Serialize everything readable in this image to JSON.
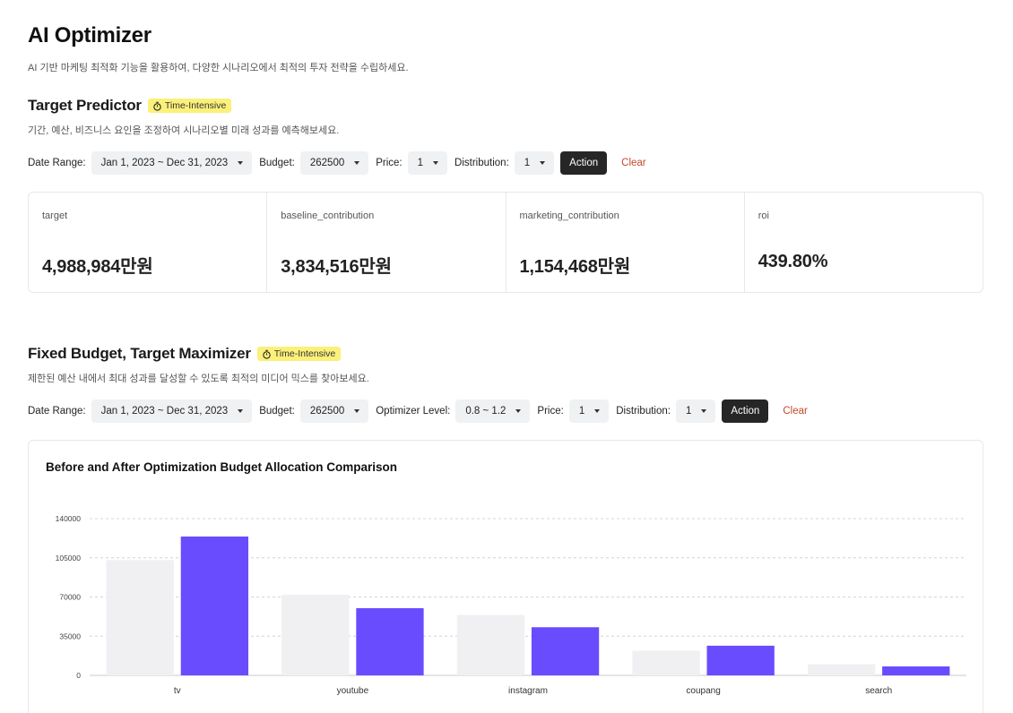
{
  "header": {
    "title": "AI Optimizer",
    "subtitle": "AI 기반 마케팅 최적화 기능을 활용하여, 다양한 시나리오에서 최적의 투자 전략을 수립하세요."
  },
  "predictor": {
    "title": "Target Predictor",
    "badge": "Time-Intensive",
    "description": "기간, 예산, 비즈니스 요인을 조정하여 시나리오별 미래 성과를 예측해보세요.",
    "controls": {
      "date_label": "Date Range:",
      "date_value": "Jan 1, 2023 ~ Dec 31, 2023",
      "budget_label": "Budget:",
      "budget_value": "262500",
      "price_label": "Price:",
      "price_value": "1",
      "distribution_label": "Distribution:",
      "distribution_value": "1",
      "action_label": "Action",
      "clear_label": "Clear"
    },
    "metrics": [
      {
        "label": "target",
        "value": "4,988,984만원"
      },
      {
        "label": "baseline_contribution",
        "value": "3,834,516만원"
      },
      {
        "label": "marketing_contribution",
        "value": "1,154,468만원"
      },
      {
        "label": "roi",
        "value": "439.80%"
      }
    ]
  },
  "maximizer": {
    "title": "Fixed Budget, Target Maximizer",
    "badge": "Time-Intensive",
    "description": "제한된 예산 내에서 최대 성과를 달성할 수 있도록 최적의 미디어 믹스를 찾아보세요.",
    "controls": {
      "date_label": "Date Range:",
      "date_value": "Jan 1, 2023 ~ Dec 31, 2023",
      "budget_label": "Budget:",
      "budget_value": "262500",
      "level_label": "Optimizer Level:",
      "level_value": "0.8 ~ 1.2",
      "price_label": "Price:",
      "price_value": "1",
      "distribution_label": "Distribution:",
      "distribution_value": "1",
      "action_label": "Action",
      "clear_label": "Clear"
    }
  },
  "colors": {
    "badge_bg": "#fbf07a",
    "action_bg": "#262626",
    "clear_text": "#c2492b",
    "before_bar": "#f0f0f3",
    "after_bar": "#6a4cff"
  },
  "chart_data": {
    "type": "bar",
    "title": "Before and After Optimization Budget Allocation Comparison",
    "categories": [
      "tv",
      "youtube",
      "instagram",
      "coupang",
      "search"
    ],
    "series": [
      {
        "values": [
          103000,
          72000,
          54000,
          22000,
          10000
        ],
        "color": "#f0f0f3"
      },
      {
        "values": [
          124000,
          60000,
          43000,
          26500,
          8000
        ],
        "color": "#6a4cff"
      }
    ],
    "yticks": [
      0,
      35000,
      70000,
      105000,
      140000
    ],
    "ylim": [
      0,
      140000
    ],
    "grid": true
  }
}
